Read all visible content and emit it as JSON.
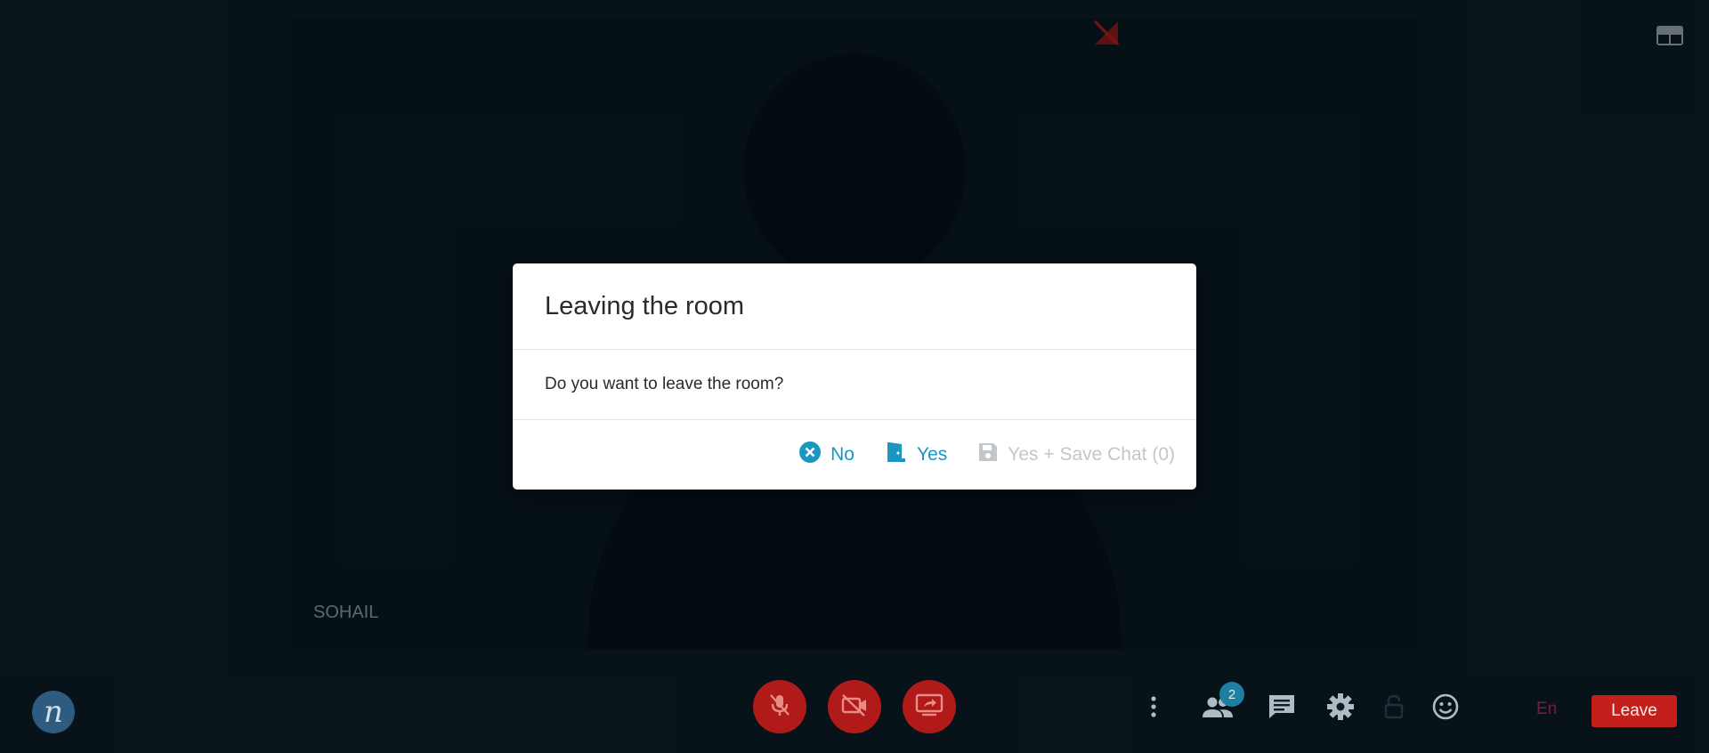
{
  "video": {
    "participant_name": "SOHAIL"
  },
  "dialog": {
    "title": "Leaving the room",
    "message": "Do you want to leave the room?",
    "buttons": {
      "no_label": "No",
      "yes_label": "Yes",
      "yes_save_label": "Yes + Save Chat (0)"
    }
  },
  "toolbar": {
    "participants_count": "2",
    "language": "En",
    "leave_label": "Leave"
  },
  "colors": {
    "accent": "#1b96c2",
    "danger": "#c3201b",
    "background": "#0c1d25"
  }
}
